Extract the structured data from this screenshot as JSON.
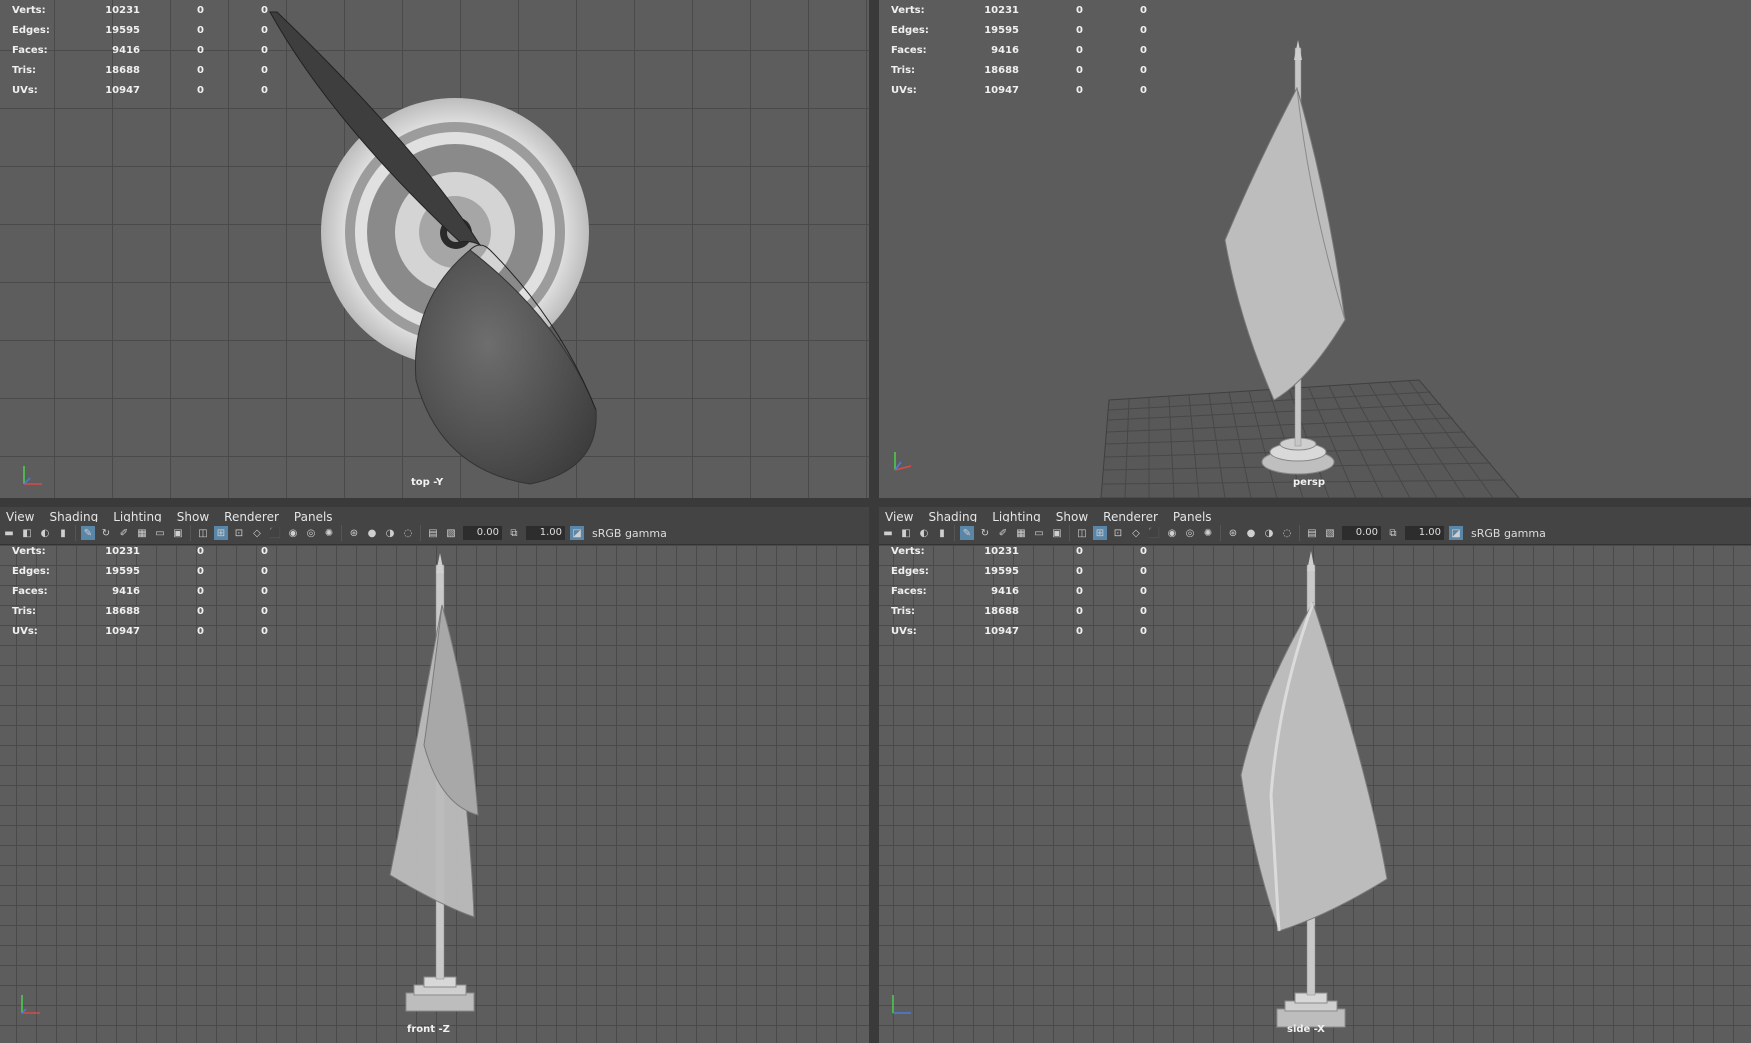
{
  "menu": [
    "View",
    "Shading",
    "Lighting",
    "Show",
    "Renderer",
    "Panels"
  ],
  "toolbar": {
    "exposure": "0.00",
    "gamma_value": "1.00",
    "color_space": "sRGB gamma",
    "icons": [
      "camera-icon",
      "camera-attr-icon",
      "bookmark-icon",
      "image-plane-icon",
      "grid-icon",
      "film-gate-icon",
      "resolution-gate-icon",
      "gate-mask-icon",
      "field-chart-icon",
      "safe-action-icon",
      "wireframe-icon",
      "smooth-shade-icon",
      "textured-icon",
      "lights-icon",
      "shadows-icon",
      "ambient-occlusion-icon",
      "motion-blur-icon",
      "anti-alias-icon",
      "depth-of-field-icon",
      "isolate-icon",
      "xray-icon",
      "xray-joints-icon",
      "backface-icon",
      "exposure-icon",
      "gamma-icon",
      "color-mgmt-icon"
    ]
  },
  "hud": {
    "labels": [
      "Verts:",
      "Edges:",
      "Faces:",
      "Tris:",
      "UVs:"
    ],
    "values": [
      [
        "10231",
        "0",
        "0"
      ],
      [
        "19595",
        "0",
        "0"
      ],
      [
        "9416",
        "0",
        "0"
      ],
      [
        "18688",
        "0",
        "0"
      ],
      [
        "10947",
        "0",
        "0"
      ]
    ]
  },
  "panels": {
    "top_left": {
      "camera": "top -Y"
    },
    "top_right": {
      "camera": "persp"
    },
    "bottom_left": {
      "camera": "front -Z"
    },
    "bottom_right": {
      "camera": "side -X"
    }
  }
}
